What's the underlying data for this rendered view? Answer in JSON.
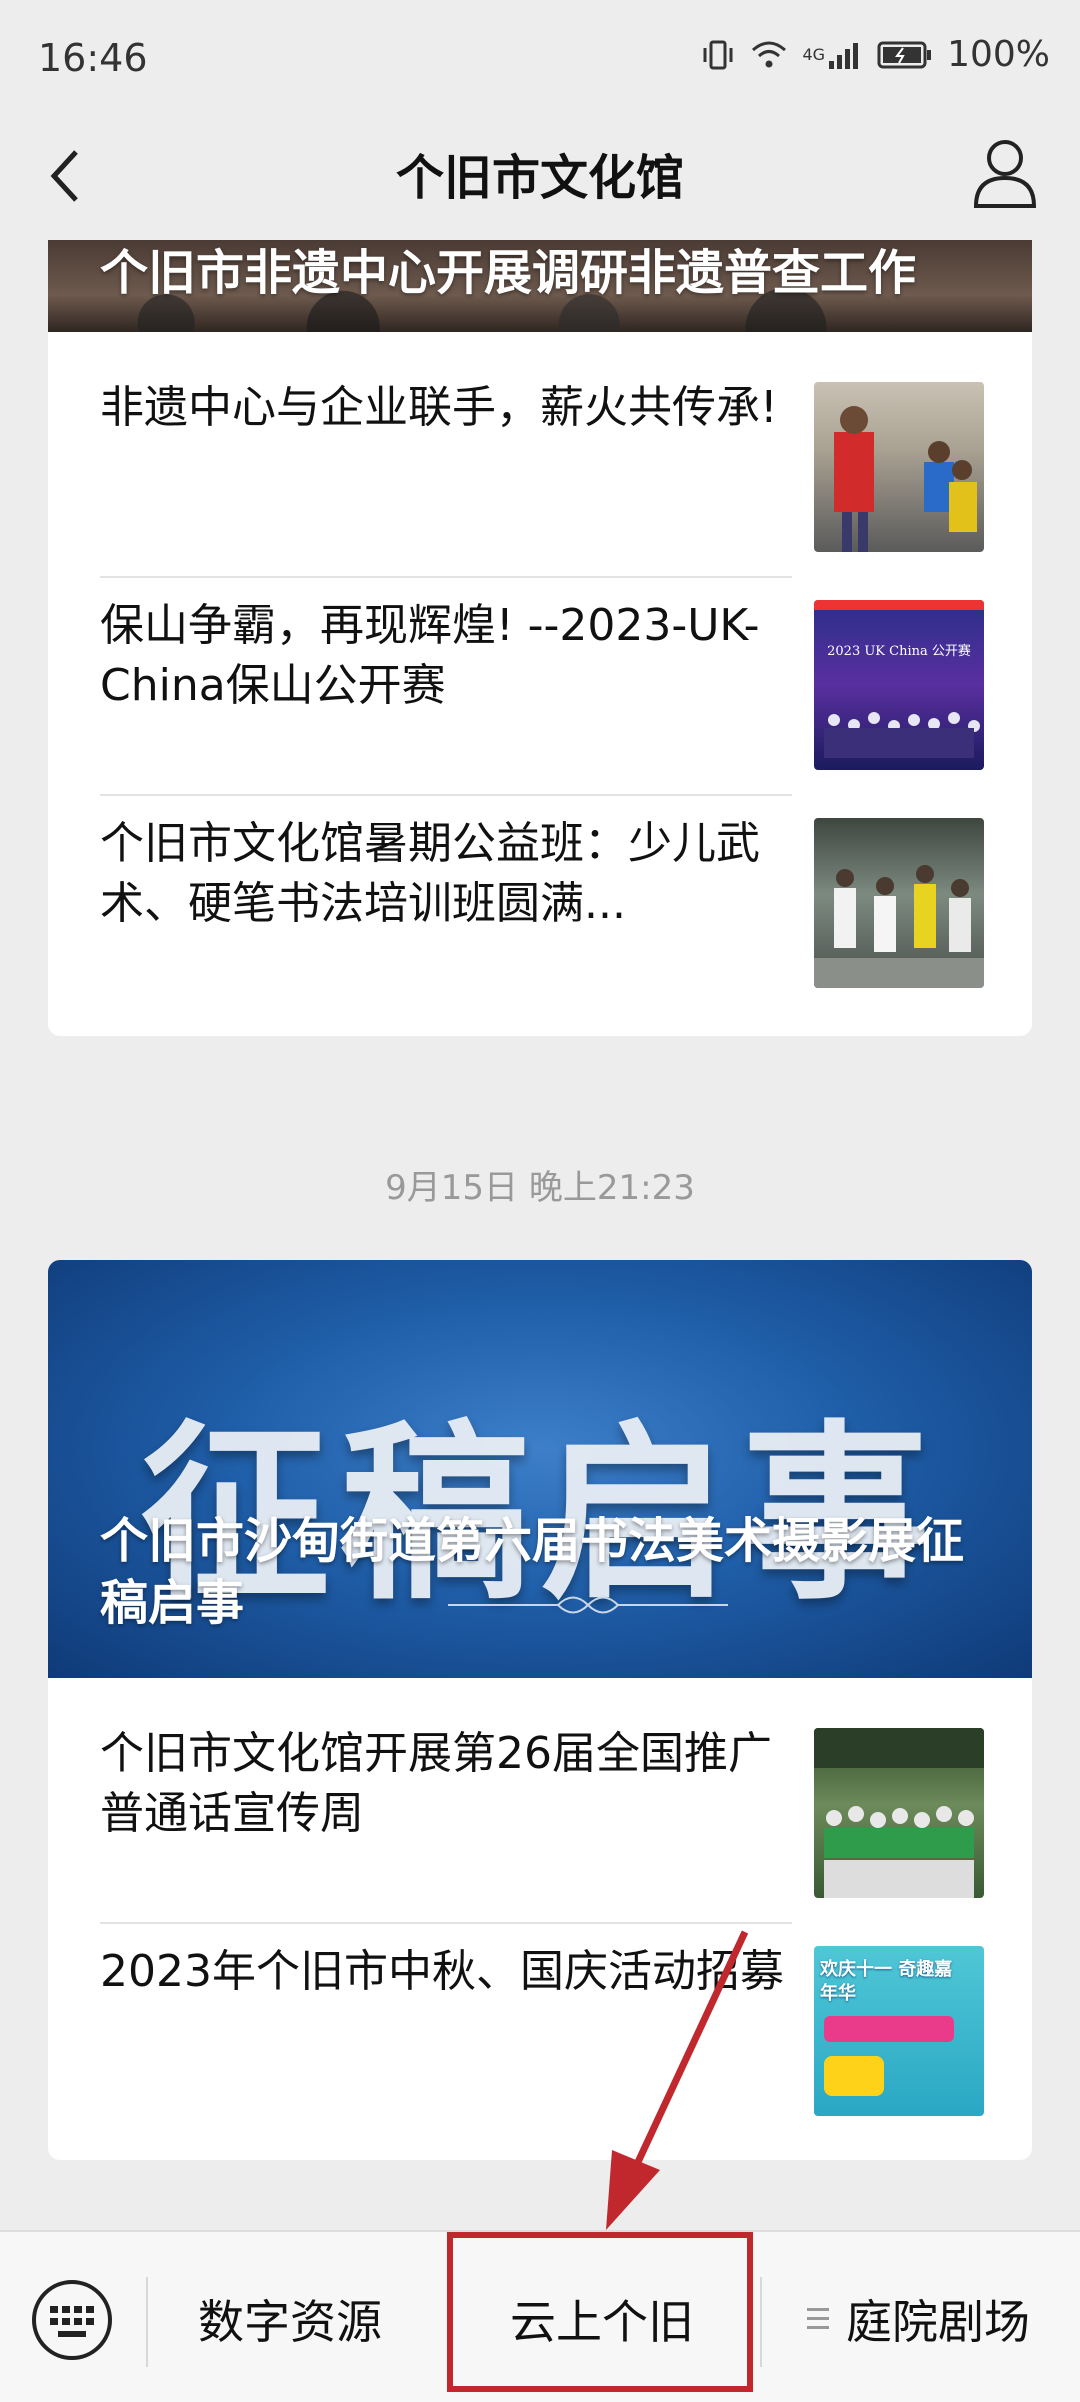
{
  "status": {
    "time": "16:46",
    "network": "4G",
    "battery": "100%"
  },
  "nav": {
    "title": "个旧市文化馆"
  },
  "card1": {
    "banner_title": "个旧市非遗中心开展调研非遗普查工作",
    "items": [
      {
        "text": "非遗中心与企业联手，薪火共传承!"
      },
      {
        "text": "保山争霸，再现辉煌! --2023-UK-China保山公开赛",
        "thumb_caption": "2023 UK China 公开赛"
      },
      {
        "text": "个旧市文化馆暑期公益班：少儿武术、硬笔书法培训班圆满..."
      }
    ]
  },
  "timestamp": "9月15日 晚上21:23",
  "card2": {
    "banner_watermark": "征稿启事",
    "banner_title": "个旧市沙甸街道第六届书法美术摄影展征稿启事",
    "items": [
      {
        "text": "个旧市文化馆开展第26届全国推广普通话宣传周"
      },
      {
        "text": "2023年个旧市中秋、国庆活动招募",
        "thumb_caption": "欢庆十一 奇趣嘉年华"
      }
    ]
  },
  "bottom_menu": {
    "items": [
      "数字资源",
      "云上个旧",
      "庭院剧场"
    ]
  },
  "colors": {
    "highlight": "#c0282d",
    "banner_blue": "#1f5ea8"
  }
}
